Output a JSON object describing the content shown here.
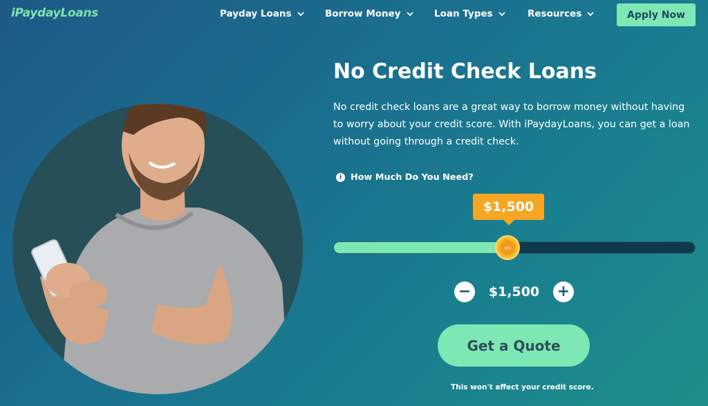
{
  "header": {
    "logo_text": "iPaydayLoans",
    "nav": [
      {
        "label": "Payday Loans",
        "icon": "chevron-down-icon"
      },
      {
        "label": "Borrow Money",
        "icon": "chevron-down-icon"
      },
      {
        "label": "Loan Types",
        "icon": "chevron-down-icon"
      },
      {
        "label": "Resources",
        "icon": "chevron-down-icon"
      }
    ],
    "apply_label": "Apply Now"
  },
  "hero": {
    "title": "No Credit Check Loans",
    "description": "No credit check loans are a great way to borrow money without having to worry about your credit score. With iPaydayLoans, you can get a loan without going through a credit check.",
    "image_alt": "man smiling at phone"
  },
  "calculator": {
    "question": "How Much Do You Need?",
    "info_icon": "info-icon",
    "amount_bubble": "$1,500",
    "slider_fraction": 0.485,
    "stepper_value": "$1,500",
    "minus_label": "−",
    "plus_label": "+",
    "thumb_glyph": "‹›",
    "quote_label": "Get a Quote",
    "disclaimer": "This won't affect your credit score."
  },
  "colors": {
    "accent_green": "#7ee8b4",
    "accent_orange": "#f5a623",
    "background": "#1a6f8e"
  }
}
